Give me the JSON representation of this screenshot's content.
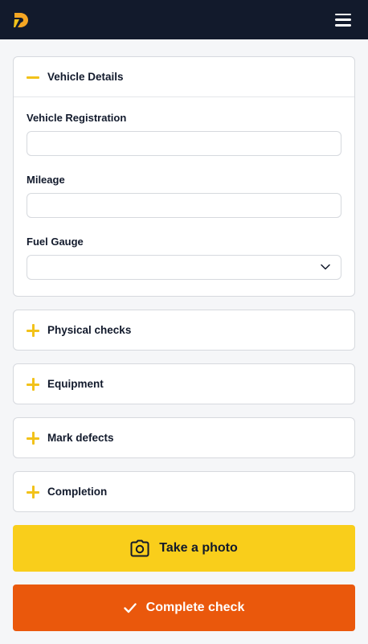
{
  "header": {
    "logo_icon": "brand-logo",
    "menu_icon": "hamburger-menu-icon",
    "colors": {
      "bar": "#121a2c",
      "logo_primary": "#f5a623",
      "logo_secondary": "#f2c21a"
    }
  },
  "sections": {
    "vehicle_details": {
      "title": "Vehicle Details",
      "expanded": true,
      "fields": {
        "registration": {
          "label": "Vehicle Registration",
          "value": ""
        },
        "mileage": {
          "label": "Mileage",
          "value": ""
        },
        "fuel_gauge": {
          "label": "Fuel Gauge",
          "selected": ""
        }
      }
    },
    "physical_checks": {
      "title": "Physical checks",
      "expanded": false
    },
    "equipment": {
      "title": "Equipment",
      "expanded": false
    },
    "mark_defects": {
      "title": "Mark defects",
      "expanded": false
    },
    "completion": {
      "title": "Completion",
      "expanded": false
    }
  },
  "actions": {
    "take_photo": {
      "label": "Take a photo",
      "icon": "camera-icon",
      "color": "#f9ce1b"
    },
    "complete_check": {
      "label": "Complete check",
      "icon": "check-icon",
      "color": "#ea580c"
    }
  },
  "accent_color": "#f2c21a"
}
